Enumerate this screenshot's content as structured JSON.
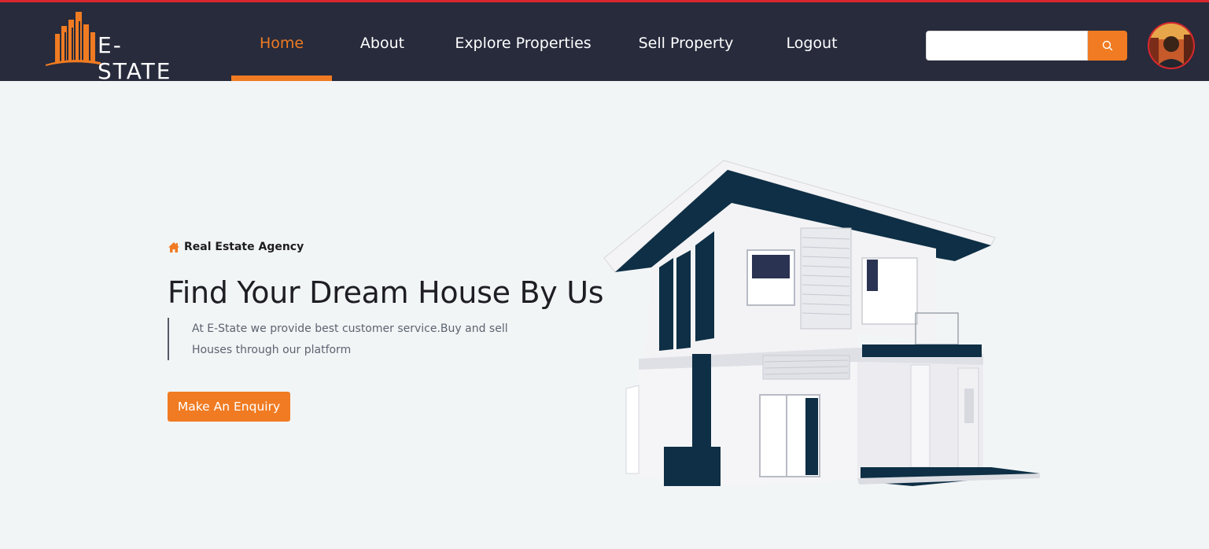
{
  "header": {
    "logo_text": "E-STATE",
    "nav": [
      {
        "label": "Home",
        "active": true
      },
      {
        "label": "About",
        "active": false
      },
      {
        "label": "Explore Properties",
        "active": false
      },
      {
        "label": "Sell Property",
        "active": false
      },
      {
        "label": "Logout",
        "active": false
      }
    ],
    "search": {
      "placeholder": "",
      "value": "",
      "icon": "search-icon"
    },
    "avatar_icon": "user-avatar"
  },
  "hero": {
    "tagline": "Real Estate Agency",
    "tagline_icon": "home-icon",
    "title": "Find Your Dream House By Us",
    "description": "At E-State we provide best customer service.Buy and sell Houses through our platform",
    "cta_label": "Make An Enquiry"
  },
  "colors": {
    "accent": "#f07b22",
    "navbar_bg": "#272b3c",
    "top_border": "#d8262f",
    "page_bg": "#f2f5f6",
    "house_dark": "#0e2f45"
  }
}
